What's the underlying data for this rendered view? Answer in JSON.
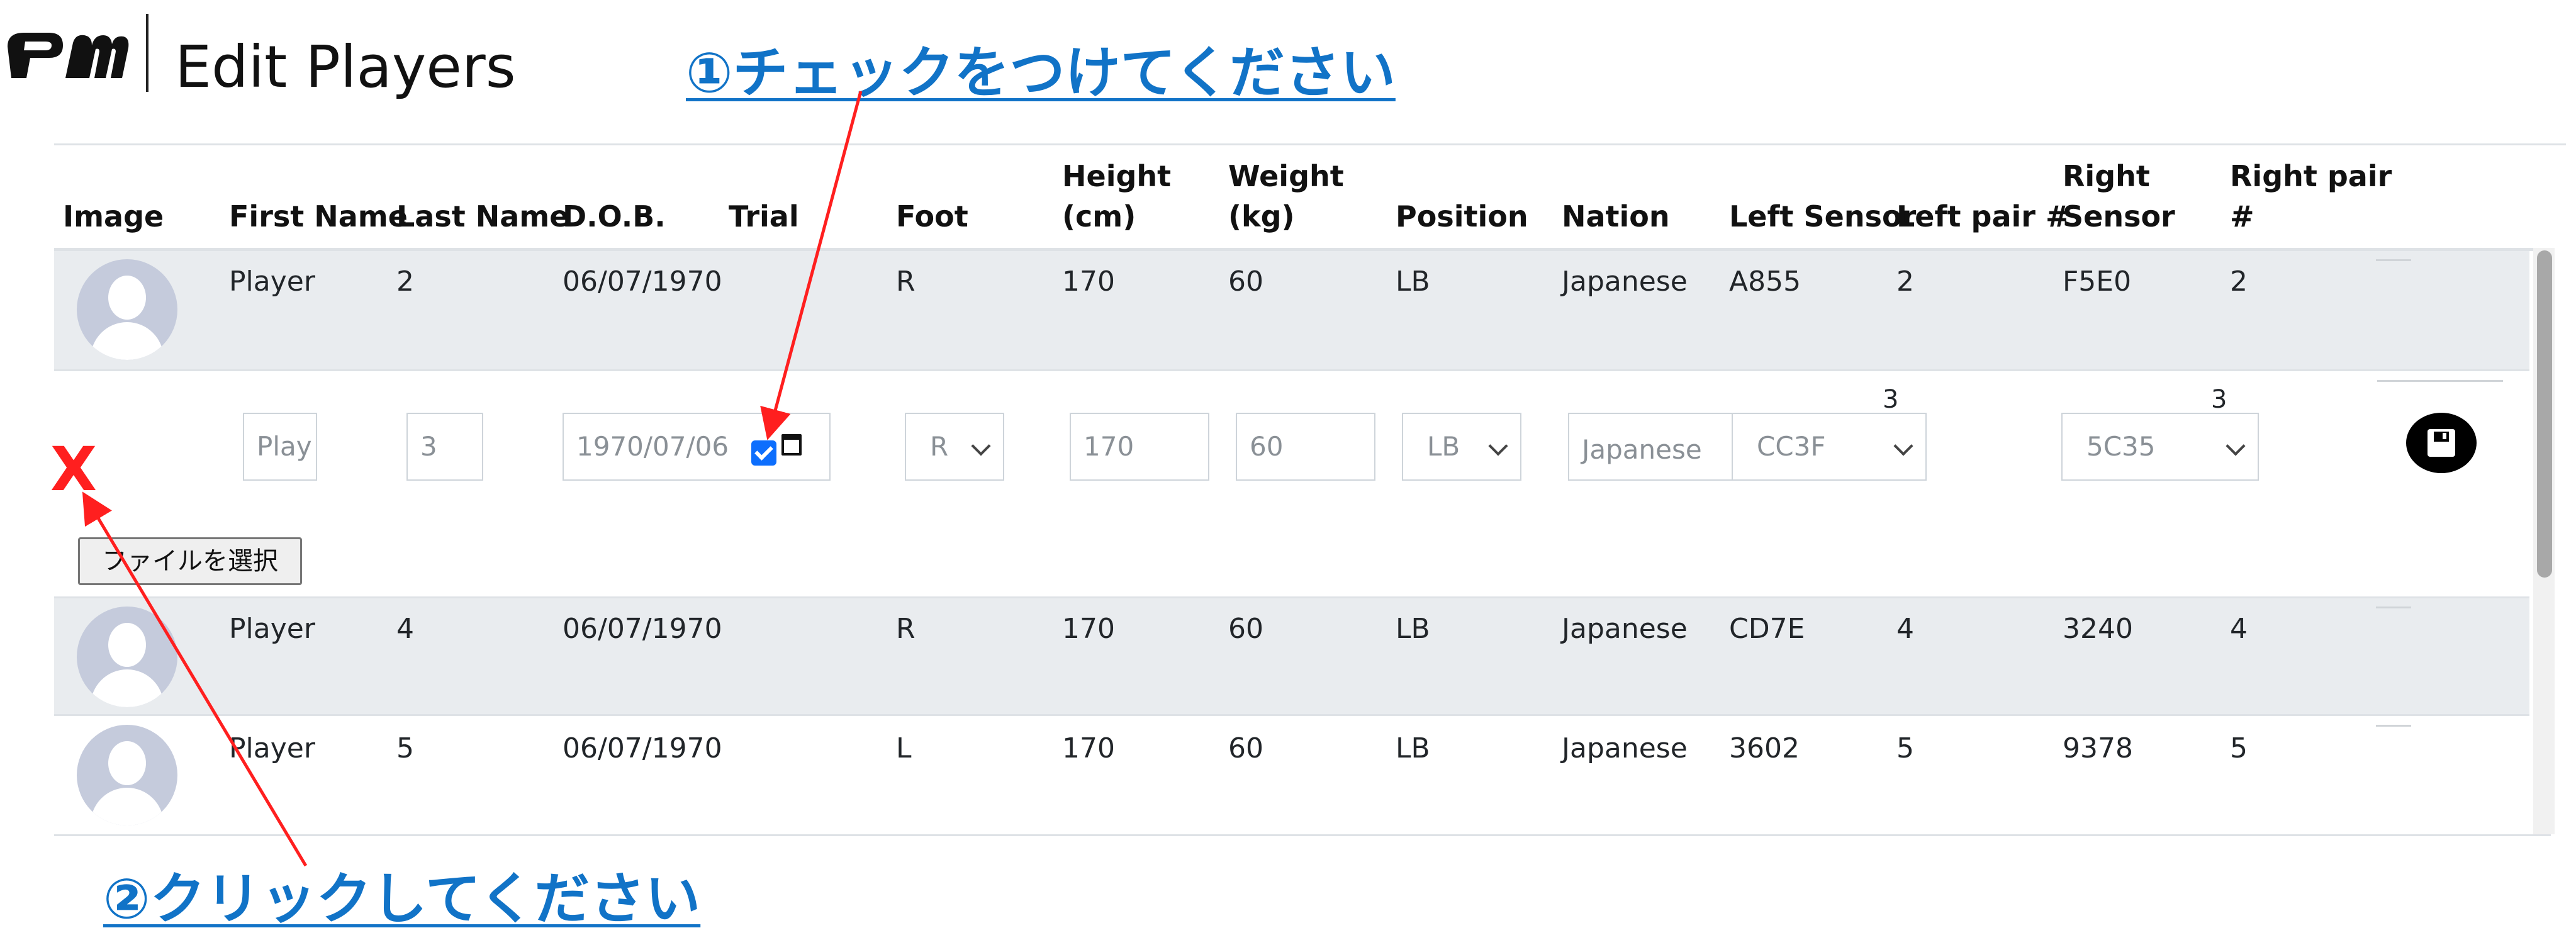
{
  "header": {
    "logo_text": "PM",
    "title": "Edit Players"
  },
  "annotations": {
    "callout_1": "①チェックをつけてください",
    "callout_2": "②クリックしてください",
    "red_x": "X"
  },
  "table": {
    "columns": {
      "image": "Image",
      "first_name": "First Name",
      "last_name": "Last Name",
      "dob": "D.O.B.",
      "trial": "Trial",
      "foot": "Foot",
      "height_1": "Height",
      "height_2": "(cm)",
      "weight_1": "Weight",
      "weight_2": "(kg)",
      "position": "Position",
      "nation": "Nation",
      "left_sensor": "Left Sensor",
      "left_pair": "Left pair #",
      "right_sensor_1": "Right",
      "right_sensor_2": "Sensor",
      "right_pair_1": "Right pair",
      "right_pair_2": "#"
    },
    "rows": [
      {
        "first_name": "Player",
        "last_name": "2",
        "dob": "06/07/1970",
        "foot": "R",
        "height": "170",
        "weight": "60",
        "position": "LB",
        "nation": "Japanese",
        "left_sensor": "A855",
        "left_pair": "2",
        "right_sensor": "F5E0",
        "right_pair": "2"
      },
      {
        "first_name": "Player",
        "last_name": "4",
        "dob": "06/07/1970",
        "foot": "R",
        "height": "170",
        "weight": "60",
        "position": "LB",
        "nation": "Japanese",
        "left_sensor": "CD7E",
        "left_pair": "4",
        "right_sensor": "3240",
        "right_pair": "4"
      },
      {
        "first_name": "Player",
        "last_name": "5",
        "dob": "06/07/1970",
        "foot": "L",
        "height": "170",
        "weight": "60",
        "position": "LB",
        "nation": "Japanese",
        "left_sensor": "3602",
        "left_pair": "5",
        "right_sensor": "9378",
        "right_pair": "5"
      }
    ],
    "edit_row": {
      "first_name": "Play",
      "last_name": "3",
      "dob": "1970/07/06",
      "trial_checked": true,
      "foot": "R",
      "height": "170",
      "weight": "60",
      "position": "LB",
      "nation": "Japanese",
      "left_pair_label": "3",
      "left_sensor": "CC3F",
      "right_pair_label": "3",
      "right_sensor": "5C35",
      "file_button": "ファイルを選択"
    }
  },
  "colors": {
    "callout": "#1173c7",
    "arrow": "#ff1f1f",
    "row_shade": "#e9ecef",
    "checkbox": "#0d6efd"
  },
  "icons": [
    "logo-icon",
    "avatar-icon",
    "calendar-icon",
    "chevron-down-icon",
    "save-icon"
  ]
}
